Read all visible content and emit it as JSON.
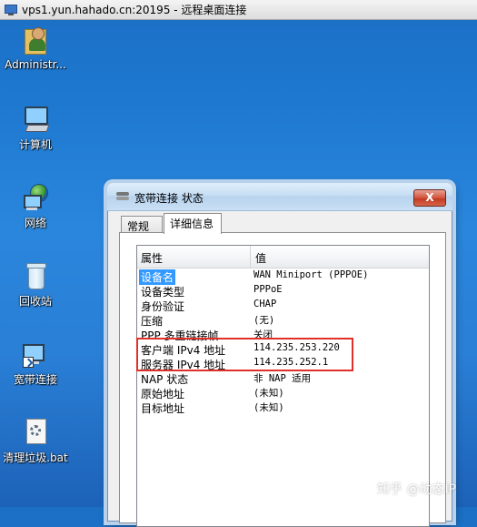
{
  "window": {
    "title": "vps1.yun.hahado.cn:20195 - 远程桌面连接",
    "icon": "remote-desktop-icon"
  },
  "desktop": {
    "icons": [
      {
        "label": "Administr...",
        "icon": "user-folder-icon"
      },
      {
        "label": "计算机",
        "icon": "computer-icon"
      },
      {
        "label": "网络",
        "icon": "network-icon"
      },
      {
        "label": "回收站",
        "icon": "recycle-bin-icon"
      },
      {
        "label": "宽带连接",
        "icon": "broadband-shortcut-icon"
      },
      {
        "label": "清理垃圾.bat",
        "icon": "batch-file-icon"
      }
    ]
  },
  "dialog": {
    "title": "宽带连接 状态",
    "close_label": "X",
    "tabs": [
      {
        "label": "常规",
        "active": false
      },
      {
        "label": "详细信息",
        "active": true
      }
    ],
    "columns": [
      "属性",
      "值"
    ],
    "rows": [
      {
        "property": "设备名",
        "value": "WAN Miniport (PPPOE)",
        "selected": true
      },
      {
        "property": "设备类型",
        "value": "PPPoE"
      },
      {
        "property": "身份验证",
        "value": "CHAP"
      },
      {
        "property": "压缩",
        "value": "(无)"
      },
      {
        "property": "PPP 多重链接帧",
        "value": "关闭"
      },
      {
        "property": "客户端 IPv4 地址",
        "value": "114.235.253.220"
      },
      {
        "property": "服务器 IPv4 地址",
        "value": "114.235.252.1"
      },
      {
        "property": "NAP 状态",
        "value": "非 NAP 适用"
      },
      {
        "property": "原始地址",
        "value": "(未知)"
      },
      {
        "property": "目标地址",
        "value": "(未知)"
      }
    ]
  },
  "watermark": "知乎 @动态IP",
  "colors": {
    "highlight": "#e0302a",
    "selection": "#3399ff",
    "close_button": "#c23a22"
  }
}
